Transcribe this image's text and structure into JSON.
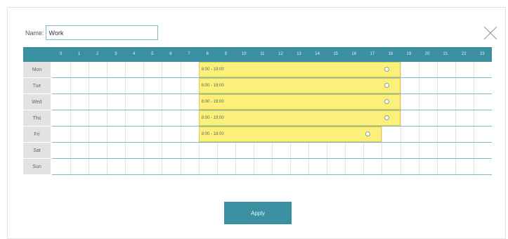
{
  "dialog": {
    "name_label": "Name:",
    "name_value": "Work",
    "close_icon": "close-icon"
  },
  "schedule": {
    "hours": [
      "0",
      "1",
      "2",
      "3",
      "4",
      "5",
      "6",
      "7",
      "8",
      "9",
      "10",
      "11",
      "12",
      "13",
      "14",
      "15",
      "16",
      "17",
      "18",
      "19",
      "20",
      "21",
      "22",
      "23"
    ],
    "days": [
      "Mon",
      "Tue",
      "Wed",
      "Thu",
      "Fri",
      "Sat",
      "Sun"
    ],
    "blocks": [
      {
        "day": "Mon",
        "start": 8,
        "end": 19,
        "label": "8:00 - 19:00"
      },
      {
        "day": "Tue",
        "start": 8,
        "end": 19,
        "label": "8:00 - 19:00"
      },
      {
        "day": "Wed",
        "start": 8,
        "end": 19,
        "label": "8:00 - 19:00"
      },
      {
        "day": "Thu",
        "start": 8,
        "end": 19,
        "label": "8:00 - 19:00"
      },
      {
        "day": "Fri",
        "start": 8,
        "end": 18,
        "label": "8:00 - 18:00"
      }
    ]
  },
  "apply_label": "Apply",
  "colors": {
    "header": "#3a8fa1",
    "block": "#fbf079",
    "accent": "#3a8fa1"
  }
}
